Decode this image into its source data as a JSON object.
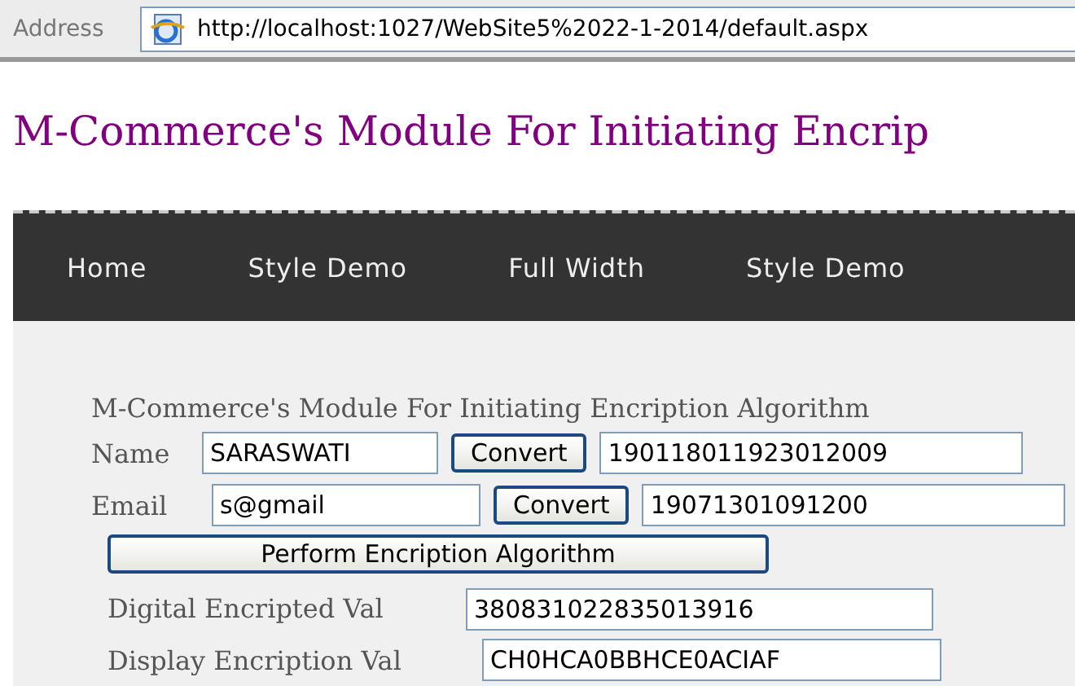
{
  "address_bar": {
    "label": "Address",
    "url": "http://localhost:1027/WebSite5%2022-1-2014/default.aspx"
  },
  "page_title": "M-Commerce's Module For Initiating Encrip",
  "nav": [
    {
      "label": "Home"
    },
    {
      "label": "Style Demo"
    },
    {
      "label": "Full Width"
    },
    {
      "label": "Style Demo"
    }
  ],
  "form": {
    "heading": "M-Commerce's Module For Initiating Encription Algorithm",
    "rows": [
      {
        "label": "Name",
        "value": "SARASWATI",
        "button": "Convert",
        "output": "190118011923012009"
      },
      {
        "label": "Email",
        "value": "s@gmail",
        "button": "Convert",
        "output": "19071301091200"
      }
    ],
    "action_button": "Perform Encription Algorithm",
    "results": [
      {
        "label": "Digital Encripted Val",
        "value": "380831022835013916"
      },
      {
        "label": "Display Encription Val",
        "value": "CH0HCA0BBHCE0ACIAF"
      }
    ]
  }
}
